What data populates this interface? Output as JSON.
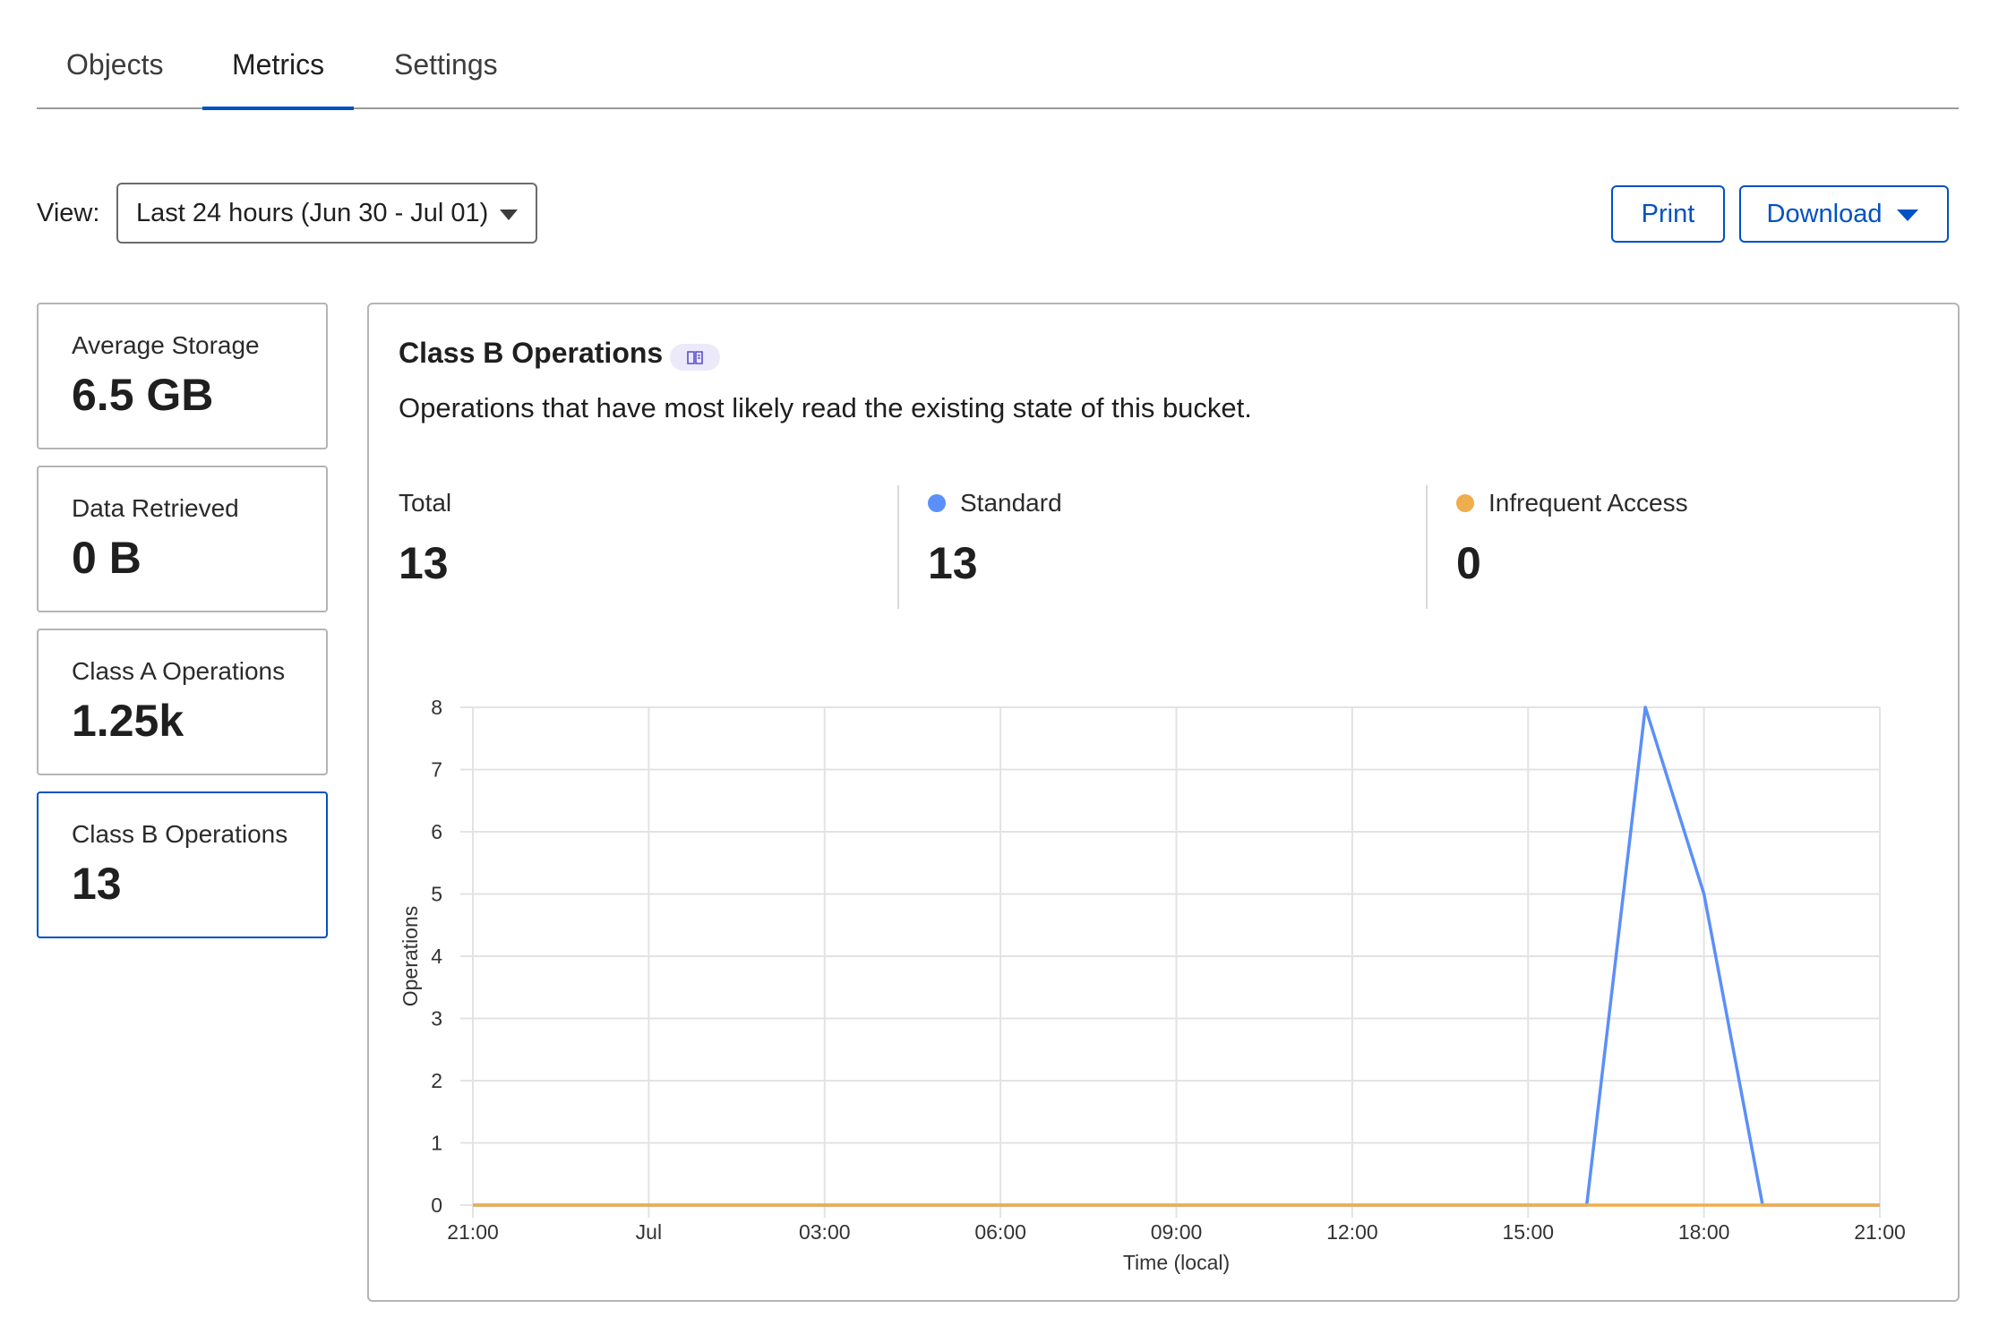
{
  "tabs": [
    {
      "label": "Objects",
      "active": false
    },
    {
      "label": "Metrics",
      "active": true
    },
    {
      "label": "Settings",
      "active": false
    }
  ],
  "view": {
    "label": "View:",
    "selected": "Last 24 hours (Jun 30 - Jul 01)"
  },
  "actions": {
    "print_label": "Print",
    "download_label": "Download"
  },
  "cards": [
    {
      "label": "Average Storage",
      "value": "6.5 GB",
      "selected": false
    },
    {
      "label": "Data Retrieved",
      "value": "0 B",
      "selected": false
    },
    {
      "label": "Class A Operations",
      "value": "1.25k",
      "selected": false
    },
    {
      "label": "Class B Operations",
      "value": "13",
      "selected": true
    }
  ],
  "panel": {
    "title": "Class B Operations",
    "description": "Operations that have most likely read the existing state of this bucket.",
    "summary": [
      {
        "label": "Total",
        "value": "13"
      },
      {
        "label": "Standard",
        "value": "13",
        "color": "#5b8ff9"
      },
      {
        "label": "Infrequent Access",
        "value": "0",
        "color": "#f0ad4e"
      }
    ]
  },
  "colors": {
    "accent": "#0051c3",
    "standard": "#5b8ff9",
    "infrequent": "#f0ad4e"
  },
  "icons": [
    "dropdown-caret-icon",
    "book-icon",
    "chevron-down-icon"
  ],
  "chart_data": {
    "type": "line",
    "xlabel": "Time (local)",
    "ylabel": "Operations",
    "x_ticks": [
      "21:00",
      "Jul",
      "03:00",
      "06:00",
      "09:00",
      "12:00",
      "15:00",
      "18:00",
      "21:00"
    ],
    "ylim": [
      0,
      8
    ],
    "y_ticks": [
      0,
      1,
      2,
      3,
      4,
      5,
      6,
      7,
      8
    ],
    "x_hours_range": [
      0,
      24
    ],
    "grid": true,
    "series": [
      {
        "name": "Standard",
        "color": "#5b8ff9",
        "x": [
          0,
          19,
          20,
          21,
          22,
          24
        ],
        "values": [
          0,
          0,
          8,
          5,
          0,
          0
        ]
      },
      {
        "name": "Infrequent Access",
        "color": "#f0ad4e",
        "x": [
          0,
          24
        ],
        "values": [
          0,
          0
        ]
      }
    ]
  }
}
